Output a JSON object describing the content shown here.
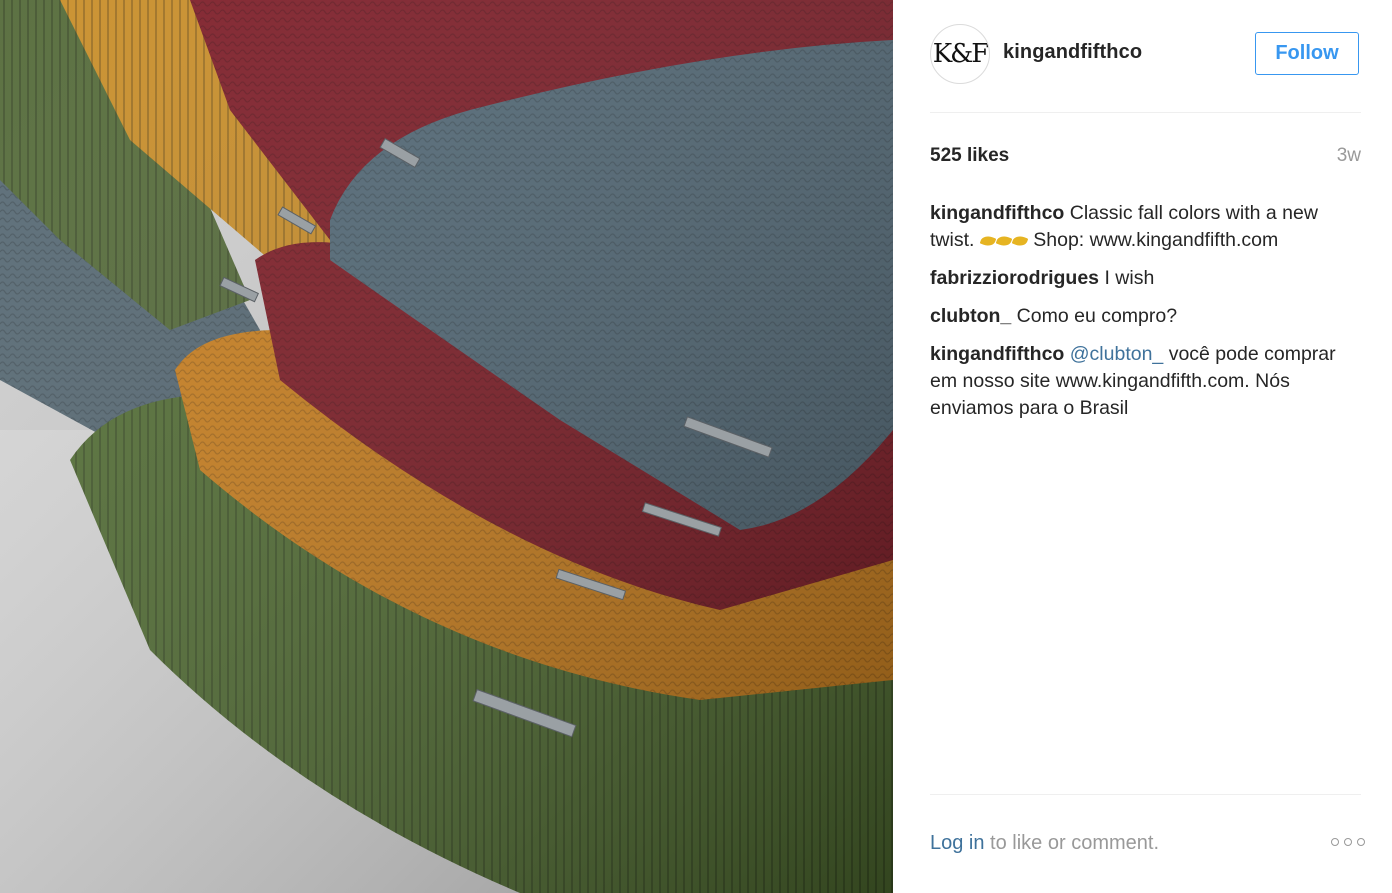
{
  "photo": {
    "icon": "knit-beanies-photo"
  },
  "header": {
    "avatar_text": "K&F",
    "username": "kingandfifthco",
    "follow_label": "Follow"
  },
  "stats": {
    "likes": "525 likes",
    "age": "3w"
  },
  "comments": [
    {
      "author": "kingandfifthco",
      "text_before": " Classic fall colors with a new twist. ",
      "emoji": "leaf-emoji-x3",
      "text_after": " Shop: www.kingandfifth.com"
    },
    {
      "author": "fabrizziorodrigues",
      "text": " I wish"
    },
    {
      "author": "clubton_",
      "text": " Como eu compro?"
    },
    {
      "author": "kingandfifthco",
      "mention": "@clubton_",
      "text": " você pode comprar em nosso site www.kingandfifth.com. Nós enviamos para o Brasil"
    }
  ],
  "footer": {
    "login_link": "Log in",
    "login_rest": " to like or comment.",
    "more_icon": "ellipsis-icon"
  },
  "colors": {
    "link": "#3f729b",
    "follow": "#3897f0",
    "muted": "#999999"
  }
}
